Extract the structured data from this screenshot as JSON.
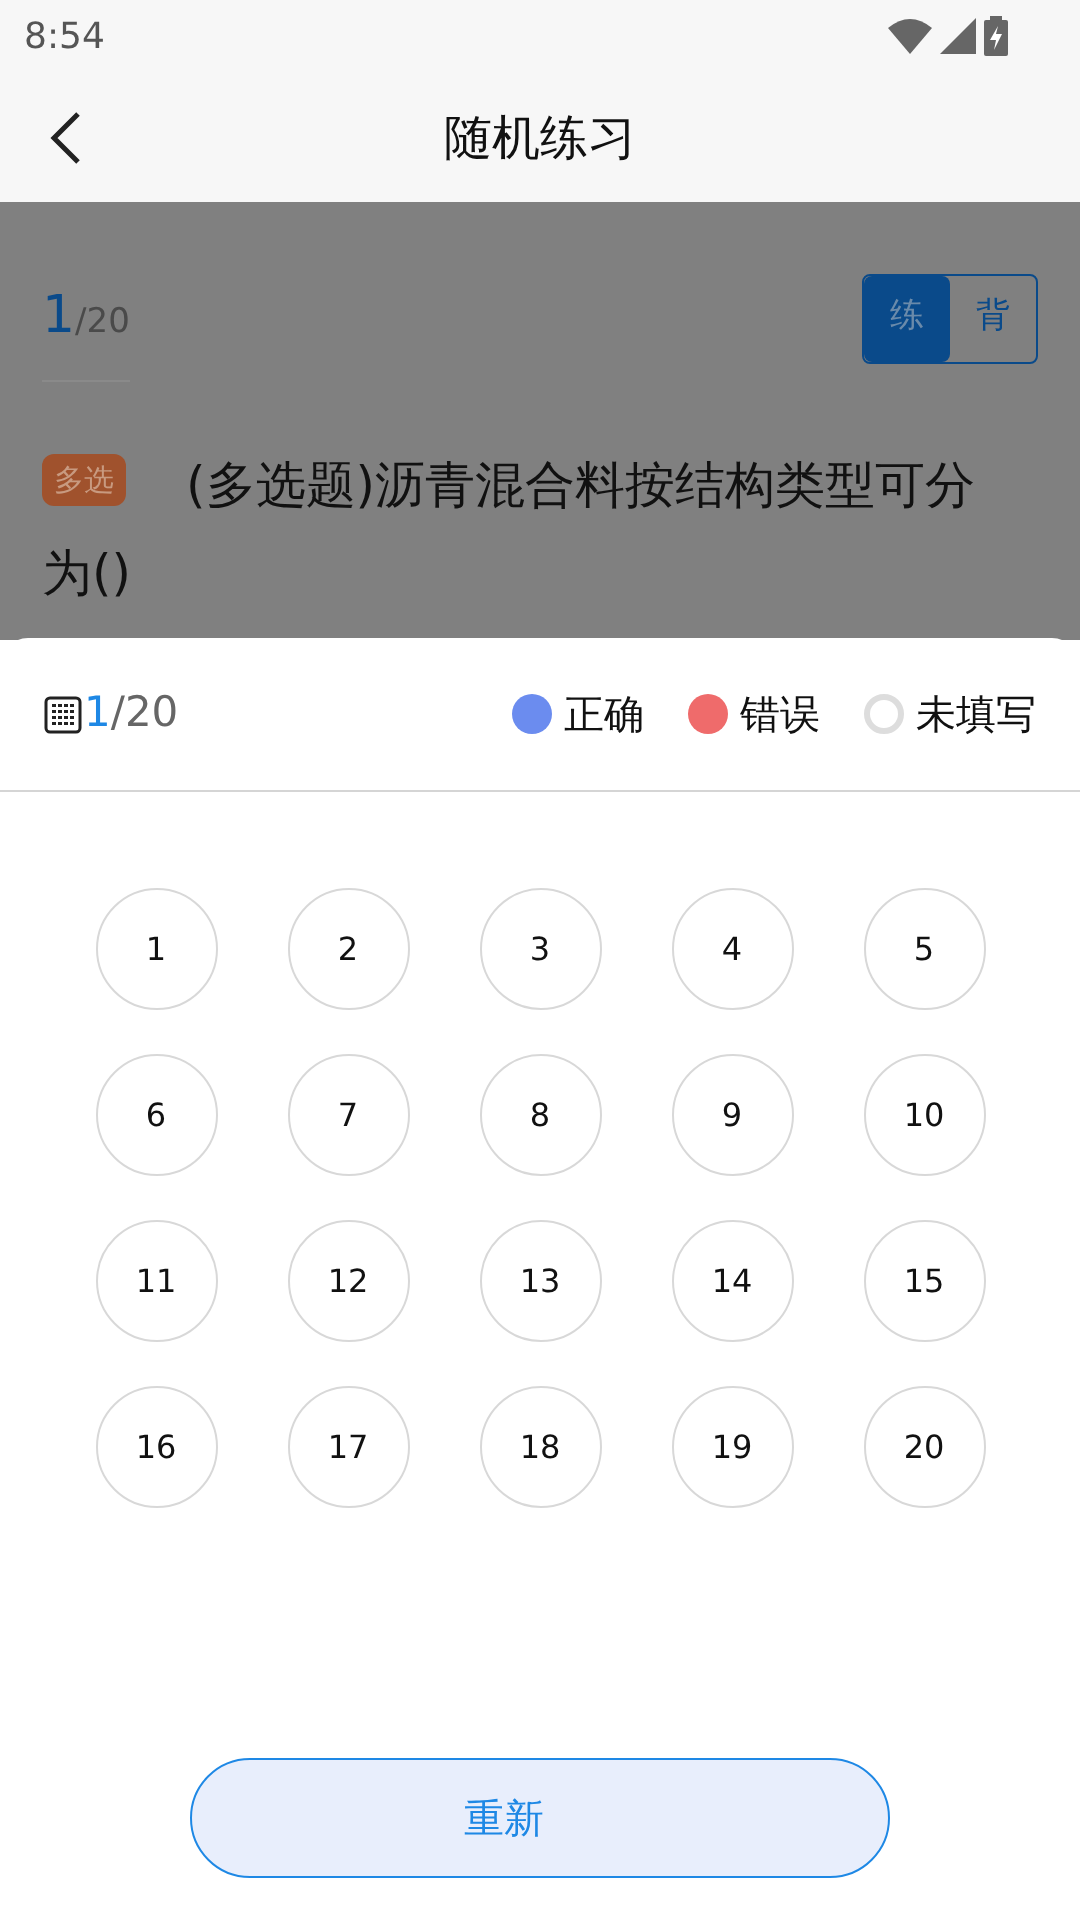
{
  "status_bar": {
    "time": "8:54"
  },
  "header": {
    "title": "随机练习"
  },
  "question": {
    "current": "1",
    "total": "/20",
    "mode_tabs": [
      {
        "label": "练",
        "selected": true
      },
      {
        "label": "背",
        "selected": false
      }
    ],
    "tag": "多选",
    "text_lines": [
      "(多选题)沥青混合料按结构类型可分",
      "为()"
    ]
  },
  "answer_sheet": {
    "current": "1",
    "total": "/20",
    "legend": [
      {
        "label": "正确",
        "color": "#6b8cef",
        "kind": "filled"
      },
      {
        "label": "错误",
        "color": "#ef6b6b",
        "kind": "filled"
      },
      {
        "label": "未填写",
        "color": "#dddddd",
        "kind": "ring"
      }
    ],
    "numbers": [
      "1",
      "2",
      "3",
      "4",
      "5",
      "6",
      "7",
      "8",
      "9",
      "10",
      "11",
      "12",
      "13",
      "14",
      "15",
      "16",
      "17",
      "18",
      "19",
      "20"
    ],
    "button": "重新"
  }
}
